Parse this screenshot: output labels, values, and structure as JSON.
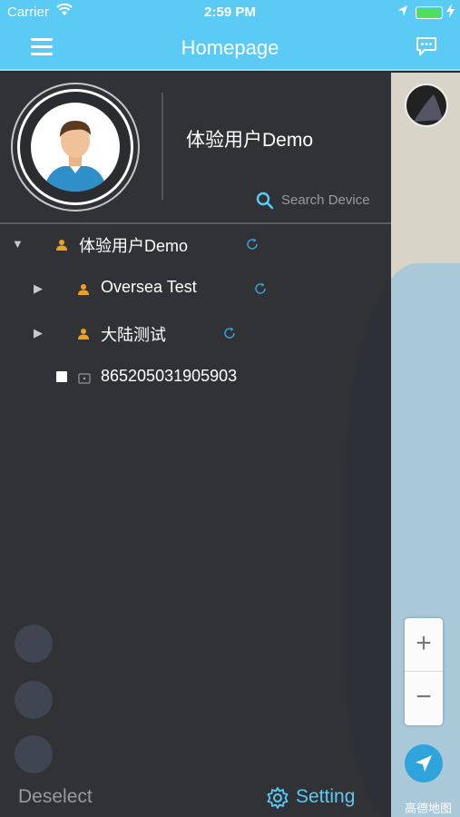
{
  "status_bar": {
    "carrier": "Carrier",
    "time": "2:59 PM"
  },
  "nav": {
    "title": "Homepage"
  },
  "drawer": {
    "user_name": "体验用户Demo",
    "search_placeholder": "Search Device",
    "tree": [
      {
        "label": "体验用户Demo",
        "type": "group",
        "expanded": true
      },
      {
        "label": "Oversea Test",
        "type": "group",
        "expanded": false
      },
      {
        "label": "大陆测试",
        "type": "group",
        "expanded": false
      },
      {
        "label": "865205031905903",
        "type": "device",
        "checked": false
      }
    ],
    "deselect_label": "Deselect",
    "setting_label": "Setting"
  },
  "map": {
    "zoom_in": "+",
    "zoom_out": "−",
    "provider_logo": "高德地图"
  },
  "colors": {
    "accent": "#5bcaf5",
    "person_icon": "#f0a020",
    "drawer_bg": "#24262a"
  }
}
